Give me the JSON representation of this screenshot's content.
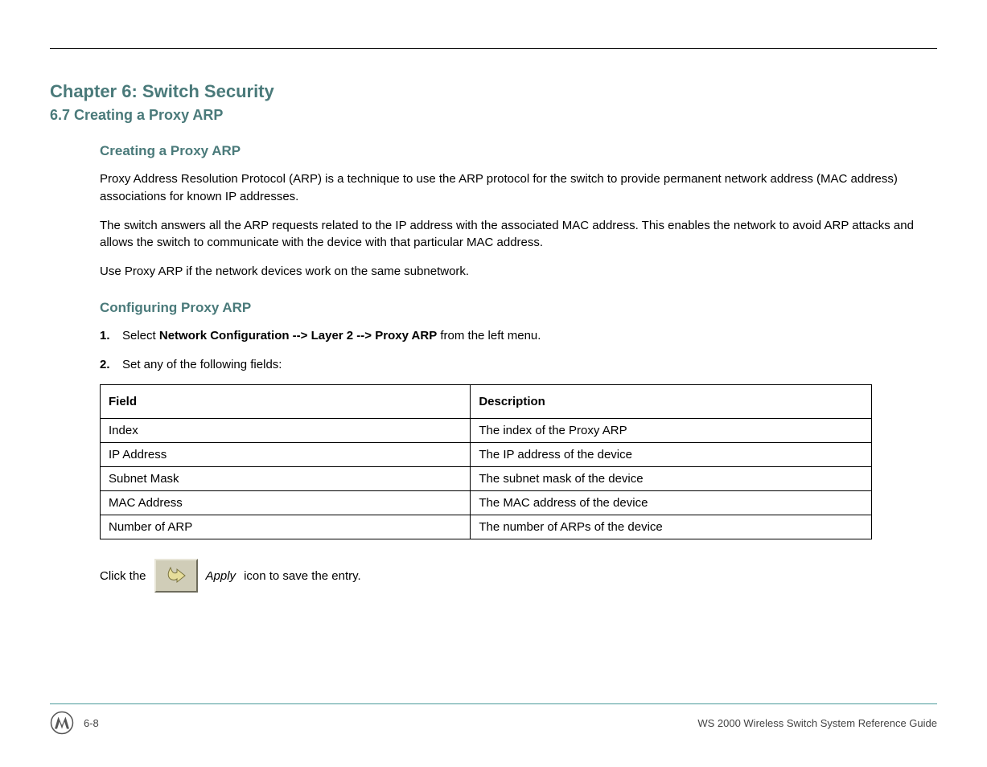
{
  "header": {
    "chapter": "Chapter 6: Switch Security",
    "section_title": "6.7 Creating a Proxy ARP",
    "section_heading": "Creating a Proxy ARP"
  },
  "intro": {
    "p1": "Proxy Address Resolution Protocol (ARP) is a technique to use the ARP protocol for the switch to provide permanent network address (MAC address) associations for known IP addresses.",
    "p2": "The switch answers all the ARP requests related to the IP address with the associated MAC address. This enables the network to avoid ARP attacks and allows the switch to communicate with the device with that particular MAC address.",
    "p3": "Use Proxy ARP if the network devices work on the same subnetwork."
  },
  "steps": {
    "heading": "Configuring Proxy ARP",
    "s1_num": "1.",
    "s1_a": "Select ",
    "s1_b": "Network Configuration --> Layer 2 --> Proxy ARP",
    "s1_c": " from the left menu.",
    "s2_num": "2.",
    "s2_text": "Set any of the following fields:"
  },
  "table": {
    "h1": "Field",
    "h2": "Description",
    "rows": [
      {
        "f": "Index",
        "d": "The index of the Proxy ARP"
      },
      {
        "f": "IP Address",
        "d": "The IP address of the device"
      },
      {
        "f": "Subnet Mask",
        "d": "The subnet mask of the device"
      },
      {
        "f": "MAC Address",
        "d": "The MAC address of the device"
      },
      {
        "f": "Number of ARP",
        "d": "The number of ARPs of the device"
      }
    ]
  },
  "apply": {
    "prefix": "Click the ",
    "label": "Apply",
    "suffix": " icon to save the entry."
  },
  "footer": {
    "page": "6-8",
    "doc": "WS 2000 Wireless Switch System Reference Guide"
  }
}
